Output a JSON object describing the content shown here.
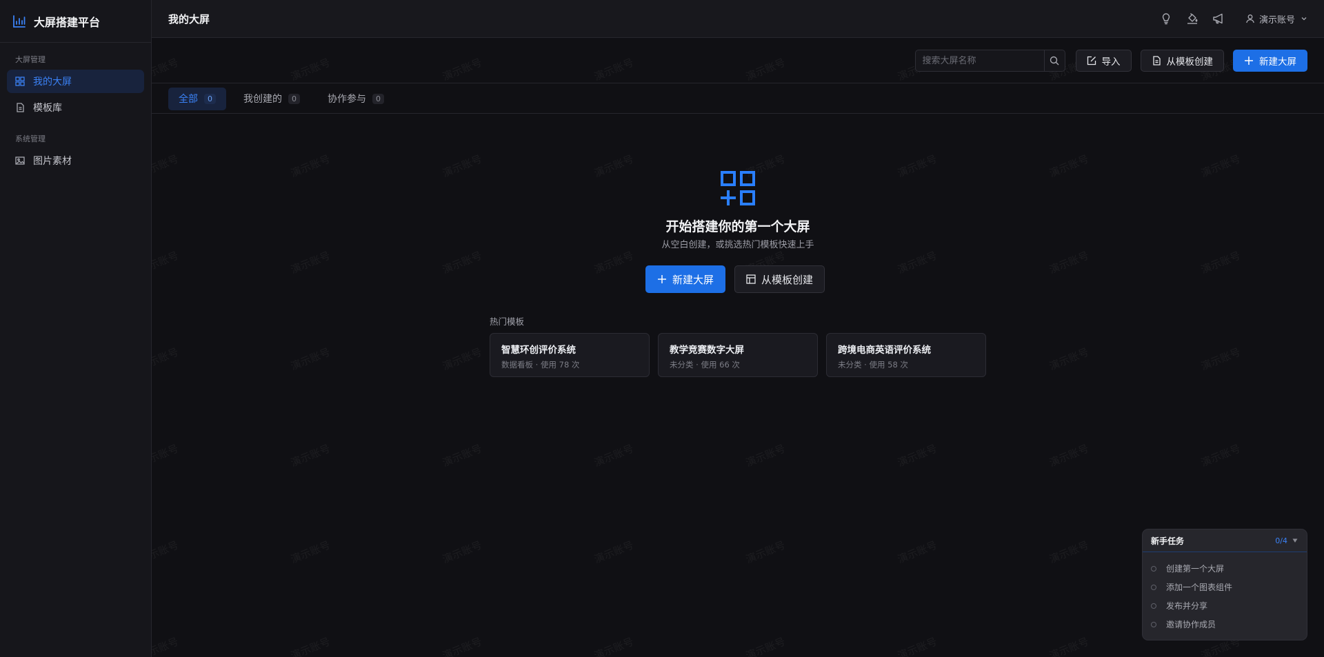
{
  "app": {
    "brand": "大屏搭建平台"
  },
  "sidebar": {
    "groups": [
      {
        "label": "大屏管理",
        "items": [
          {
            "label": "我的大屏",
            "icon": "grid-icon",
            "active": true
          },
          {
            "label": "模板库",
            "icon": "file-icon",
            "active": false
          }
        ]
      },
      {
        "label": "系统管理",
        "items": [
          {
            "label": "图片素材",
            "icon": "image-icon",
            "active": false
          }
        ]
      }
    ]
  },
  "header": {
    "title": "我的大屏",
    "icons": [
      "lightbulb-icon",
      "paint-bucket-icon",
      "megaphone-icon"
    ],
    "user": "演示账号"
  },
  "toolbar": {
    "search_placeholder": "搜索大屏名称",
    "import_label": "导入",
    "template_label": "从模板创建",
    "new_label": "新建大屏"
  },
  "tabs": [
    {
      "label": "全部",
      "count": "0",
      "active": true
    },
    {
      "label": "我创建的",
      "count": "0",
      "active": false
    },
    {
      "label": "协作参与",
      "count": "0",
      "active": false
    }
  ],
  "empty": {
    "title": "开始搭建你的第一个大屏",
    "subtitle": "从空白创建，或挑选热门模板快速上手",
    "new_label": "新建大屏",
    "template_label": "从模板创建"
  },
  "hot_templates": {
    "label": "热门模板",
    "items": [
      {
        "title": "智慧环创评价系统",
        "meta": "数据看板 · 使用 78 次"
      },
      {
        "title": "教学竞赛数字大屏",
        "meta": "未分类 · 使用 66 次"
      },
      {
        "title": "跨境电商英语评价系统",
        "meta": "未分类 · 使用 58 次"
      }
    ]
  },
  "onboarding": {
    "title": "新手任务",
    "progress": "0/4",
    "tasks": [
      "创建第一个大屏",
      "添加一个图表组件",
      "发布并分享",
      "邀请协作成员"
    ]
  },
  "watermark": "演示账号",
  "colors": {
    "accent": "#1d6fe6",
    "accent_text": "#3b82f6",
    "background": "#101014",
    "sidebar": "#16161b"
  }
}
